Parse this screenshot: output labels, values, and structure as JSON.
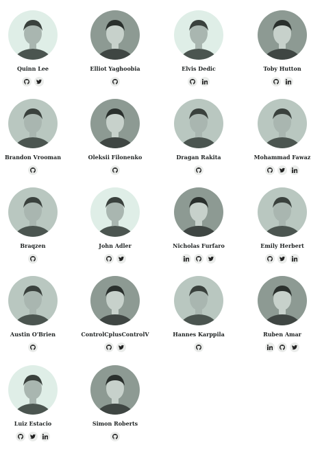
{
  "members": [
    {
      "name": "Quinn Lee",
      "tone": "light",
      "socials": [
        "github",
        "twitter"
      ]
    },
    {
      "name": "Elliot Yaghoobia",
      "tone": "dark",
      "socials": [
        "github"
      ]
    },
    {
      "name": "Elvis Dedic",
      "tone": "light",
      "socials": [
        "github",
        "linkedin"
      ]
    },
    {
      "name": "Toby Hutton",
      "tone": "dark",
      "socials": [
        "github",
        "linkedin"
      ]
    },
    {
      "name": "Brandon Vrooman",
      "tone": "mid",
      "socials": [
        "github"
      ]
    },
    {
      "name": "Oleksii Filonenko",
      "tone": "dark",
      "socials": [
        "github"
      ]
    },
    {
      "name": "Dragan Rakita",
      "tone": "mid",
      "socials": [
        "github"
      ]
    },
    {
      "name": "Mohammad Fawaz",
      "tone": "mid",
      "socials": [
        "github",
        "twitter",
        "linkedin"
      ]
    },
    {
      "name": "Braqzen",
      "tone": "mid",
      "socials": [
        "github"
      ]
    },
    {
      "name": "John Adler",
      "tone": "light",
      "socials": [
        "github",
        "twitter"
      ]
    },
    {
      "name": "Nicholas Furfaro",
      "tone": "dark",
      "socials": [
        "linkedin",
        "github",
        "twitter"
      ]
    },
    {
      "name": "Emily Herbert",
      "tone": "mid",
      "socials": [
        "github",
        "twitter",
        "linkedin"
      ]
    },
    {
      "name": "Austin O'Brien",
      "tone": "mid",
      "socials": [
        "github"
      ]
    },
    {
      "name": "ControlCplusControlV",
      "tone": "dark",
      "socials": [
        "github",
        "twitter"
      ]
    },
    {
      "name": "Hannes Karppila",
      "tone": "mid",
      "socials": [
        "github"
      ]
    },
    {
      "name": "Ruben Amar",
      "tone": "dark",
      "socials": [
        "linkedin",
        "github",
        "twitter"
      ]
    },
    {
      "name": "Luiz Estacio",
      "tone": "light",
      "socials": [
        "github",
        "twitter",
        "linkedin"
      ]
    },
    {
      "name": "Simon Roberts",
      "tone": "dark",
      "socials": [
        "github"
      ]
    }
  ],
  "icons": {
    "github": "github-icon",
    "twitter": "twitter-icon",
    "linkedin": "linkedin-icon"
  },
  "colors": {
    "avatar_light": "#dfeee7",
    "avatar_dark": "#8d9a93",
    "icon_bg": "#eaecea",
    "text": "#1e2222"
  }
}
